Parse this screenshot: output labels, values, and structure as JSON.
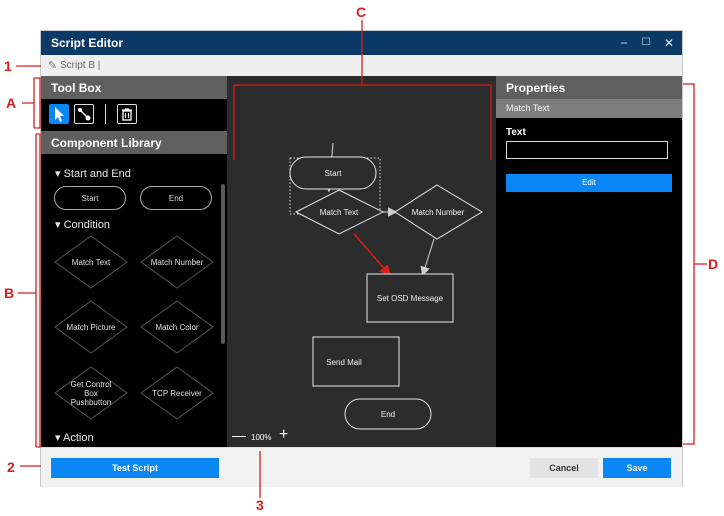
{
  "window": {
    "title": "Script Editor",
    "controls": [
      "−",
      "☐",
      "✕"
    ]
  },
  "script_bar": {
    "name": "Script B |"
  },
  "toolbox": {
    "title": "Tool Box",
    "tools": [
      "select-icon",
      "connector-icon",
      "delete-icon"
    ]
  },
  "component_library": {
    "title": "Component Library",
    "sections": [
      {
        "title": "Start and End",
        "items": [
          "Start",
          "End"
        ]
      },
      {
        "title": "Condition",
        "items": [
          "Match Text",
          "Match Number",
          "Match Picture",
          "Match Color",
          "Get Control Box Pushbutton",
          "TCP Receiver"
        ]
      },
      {
        "title": "Action"
      }
    ]
  },
  "flow": {
    "nodes": {
      "start": "Start",
      "match_text": "Match Text",
      "match_number": "Match Number",
      "set_osd": "Set OSD Message",
      "send_mail": "Send Mail",
      "end": "End"
    }
  },
  "zoom": {
    "level": "100%",
    "minus": "—",
    "plus": "+"
  },
  "properties": {
    "title": "Properties",
    "selected": "Match Text",
    "field_label": "Text",
    "field_value": "",
    "edit_label": "Edit"
  },
  "bottom": {
    "test_label": "Test Script",
    "cancel_label": "Cancel",
    "save_label": "Save"
  },
  "annotations": {
    "1": "1",
    "2": "2",
    "3": "3",
    "A": "A",
    "B": "B",
    "C": "C",
    "D": "D"
  },
  "colors": {
    "accent": "#0b86f5",
    "titlebar": "#0b3a67",
    "annotation": "#d91e1e",
    "panel_header": "#5f5f5f"
  }
}
